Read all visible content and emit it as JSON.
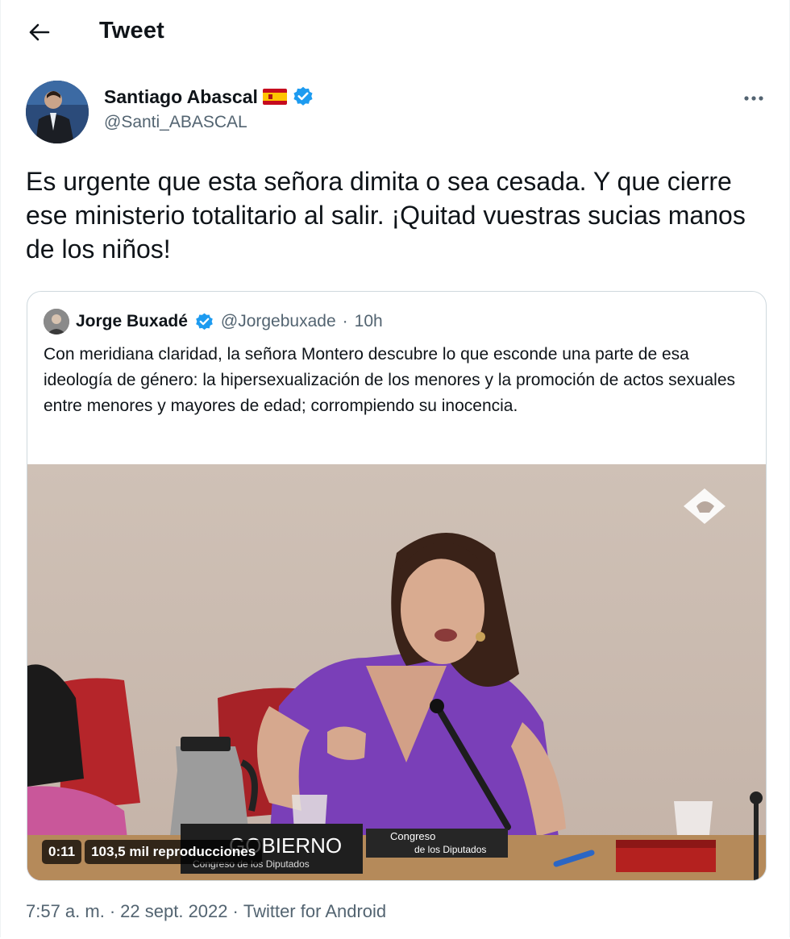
{
  "header": {
    "title": "Tweet"
  },
  "tweet": {
    "author_name": "Santiago Abascal",
    "author_handle": "@Santi_ABASCAL",
    "text": "Es urgente que esta señora dimita o sea cesada. Y que cierre ese ministerio totalitario al salir. ¡Quitad vuestras sucias manos de los niños!",
    "time": "7:57 a. m.",
    "separator": "·",
    "date": "22 sept. 2022",
    "source": "Twitter for Android"
  },
  "quoted": {
    "author_name": "Jorge Buxadé",
    "author_handle": "@Jorgebuxade",
    "separator": "·",
    "age": "10h",
    "text": "Con meridiana claridad, la señora Montero descubre lo que esconde una parte de esa ideología de género: la hipersexualización de los menores y la promoción de actos sexuales entre menores y mayores de edad; corrompiendo su inocencia.",
    "video": {
      "duration": "0:11",
      "views": "103,5 mil reproducciones",
      "placard_text": "GOBIERNO",
      "placard_sub": "Congreso de los Diputados",
      "sign_line1": "Congreso",
      "sign_line2": "de los Diputados"
    }
  },
  "colors": {
    "verified": "#1d9bf0",
    "secondary_text": "#536471",
    "border": "#cfd9de"
  },
  "icons": {
    "back": "arrow-left-icon",
    "verified": "verified-badge-icon",
    "flag": "spain-flag-icon",
    "more": "more-horizontal-icon"
  }
}
